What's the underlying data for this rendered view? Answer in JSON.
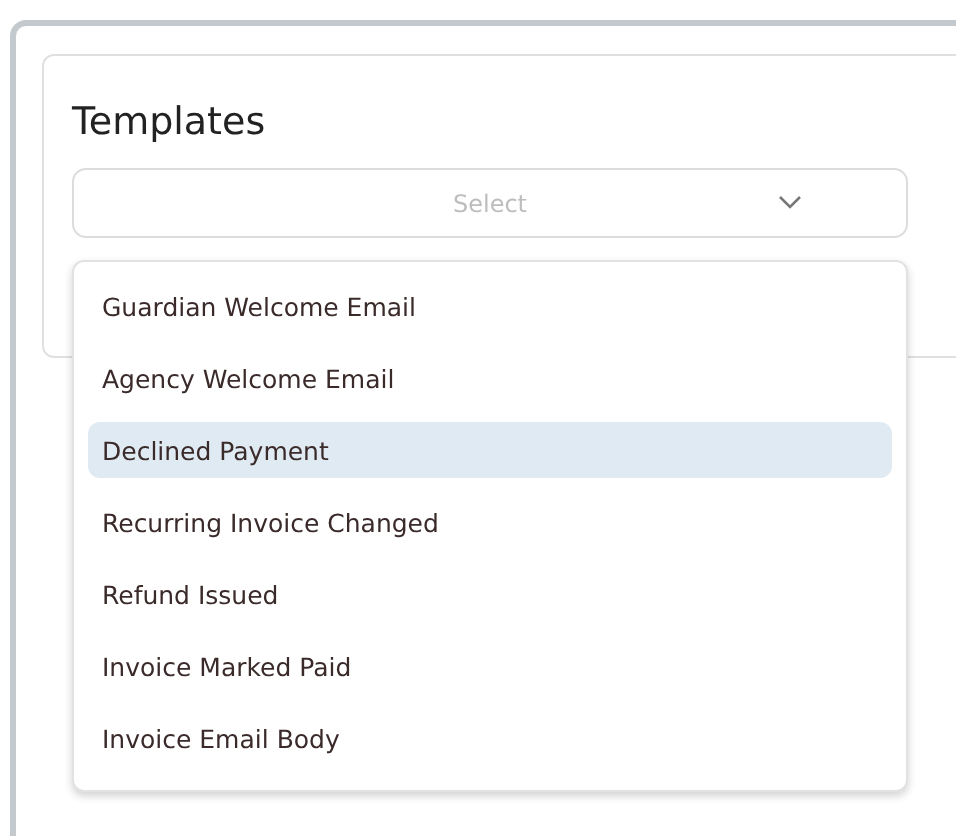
{
  "card": {
    "title": "Templates"
  },
  "select": {
    "placeholder": "Select",
    "expanded": true
  },
  "options": [
    {
      "label": "Guardian Welcome Email",
      "selected": false
    },
    {
      "label": "Agency Welcome Email",
      "selected": false
    },
    {
      "label": "Declined Payment",
      "selected": true
    },
    {
      "label": "Recurring Invoice Changed",
      "selected": false
    },
    {
      "label": "Refund Issued",
      "selected": false
    },
    {
      "label": "Invoice Marked Paid",
      "selected": false
    },
    {
      "label": "Invoice Email Body",
      "selected": false
    }
  ]
}
